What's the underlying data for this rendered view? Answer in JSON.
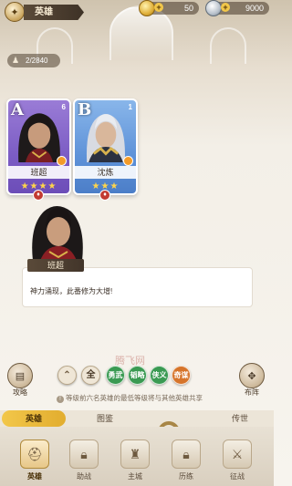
{
  "header": {
    "title": "英雄",
    "coins": "50",
    "gems": "9000"
  },
  "hero_count": "2/2840",
  "cards": [
    {
      "grade": "A",
      "level": "6",
      "name": "班超",
      "stars": "★★★★"
    },
    {
      "grade": "B",
      "level": "1",
      "name": "沈炼",
      "stars": "★★★"
    }
  ],
  "dialog": {
    "speaker": "班超",
    "text": "神力涌现，此番修为大增!"
  },
  "watermark": "腾飞网",
  "side_buttons": {
    "left_label": "攻略",
    "right_label": "布阵"
  },
  "filters": [
    "全",
    "勇武",
    "韬略",
    "侠义",
    "奇谋"
  ],
  "hint": "等级前六名英雄的最低等级将与其他英雄共享",
  "tabs": [
    "英雄",
    "图鉴",
    "传世"
  ],
  "nav": [
    "英雄",
    "助战",
    "主城",
    "历练",
    "征战"
  ],
  "icons": {
    "back": "compass-icon",
    "coin": "coin-icon",
    "gem": "gem-icon",
    "people": "people-icon"
  }
}
